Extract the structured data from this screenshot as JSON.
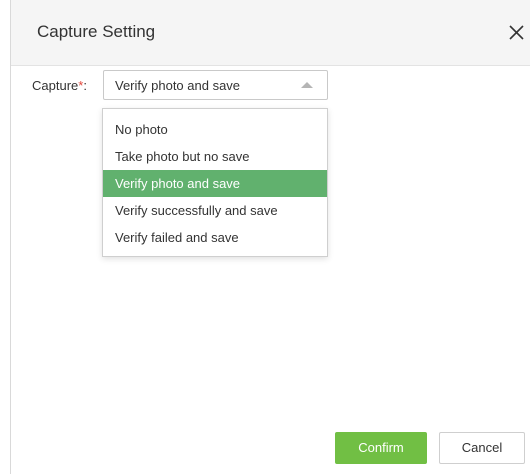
{
  "dialog": {
    "title": "Capture Setting",
    "close_icon": "close-icon"
  },
  "form": {
    "label": "Capture",
    "required_mark": "*",
    "colon": ":",
    "selected_value": "Verify photo and save",
    "dropdown_state": "open"
  },
  "options": [
    {
      "label": "No photo",
      "selected": false
    },
    {
      "label": "Take photo but no save",
      "selected": false
    },
    {
      "label": "Verify photo and save",
      "selected": true
    },
    {
      "label": "Verify successfully and save",
      "selected": false
    },
    {
      "label": "Verify failed and save",
      "selected": false
    }
  ],
  "buttons": {
    "confirm": "Confirm",
    "cancel": "Cancel"
  },
  "colors": {
    "selected_option": "#61b16e",
    "confirm_button": "#71bf44",
    "required_mark": "#e2463b"
  }
}
